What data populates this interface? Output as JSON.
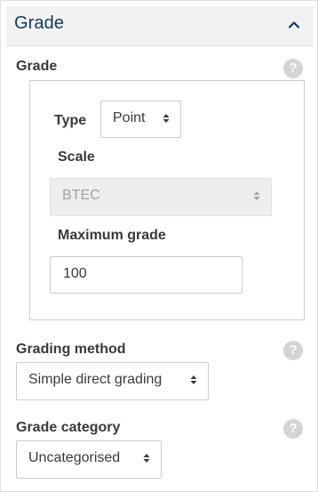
{
  "section": {
    "title": "Grade"
  },
  "grade": {
    "label": "Grade",
    "help": "?",
    "type_label": "Type",
    "type_value": "Point",
    "scale_label": "Scale",
    "scale_value": "BTEC",
    "max_grade_label": "Maximum grade",
    "max_grade_value": "100"
  },
  "grading_method": {
    "label": "Grading method",
    "help": "?",
    "value": "Simple direct grading"
  },
  "grade_category": {
    "label": "Grade category",
    "help": "?",
    "value": "Uncategorised"
  }
}
